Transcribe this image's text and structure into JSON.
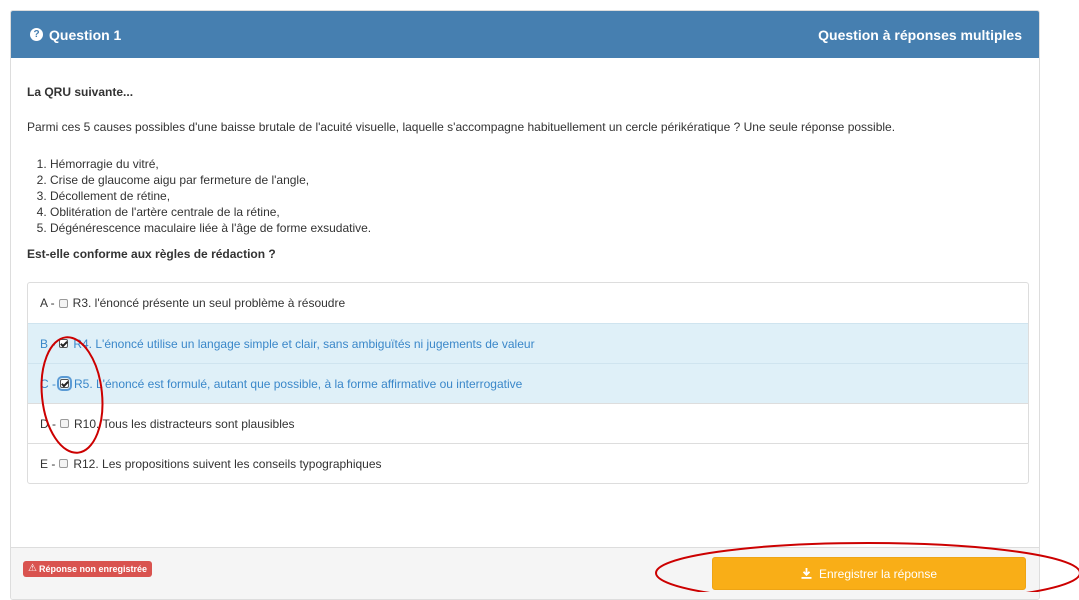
{
  "header": {
    "title": "Question 1",
    "type_label": "Question à réponses multiples",
    "icon": "question-circle-icon"
  },
  "body": {
    "intro": "La QRU suivante...",
    "stem": "Parmi ces 5 causes possibles d'une baisse brutale de l'acuité visuelle, laquelle s'accompagne habituellement un cercle périkératique ? Une seule réponse possible.",
    "causes": [
      "Hémorragie du vitré,",
      "Crise de glaucome aigu par fermeture de l'angle,",
      "Décollement de rétine,",
      "Oblitération de l'artère centrale de la rétine,",
      "Dégénérescence maculaire liée à l'âge de forme exsudative."
    ],
    "question": "Est-elle conforme aux règles de rédaction ?"
  },
  "options": [
    {
      "letter": "A -",
      "text": "R3. l'énoncé présente un seul problème à résoudre",
      "checked": false
    },
    {
      "letter": "B -",
      "text": "R4. L'énoncé utilise un langage simple et clair, sans ambiguïtés ni jugements de valeur",
      "checked": true
    },
    {
      "letter": "C -",
      "text": "R5. L'énoncé est formulé, autant que possible, à la forme affirmative ou interrogative",
      "checked": true
    },
    {
      "letter": "D -",
      "text": "R10. Tous les distracteurs sont plausibles",
      "checked": false
    },
    {
      "letter": "E -",
      "text": "R12. Les propositions suivent les conseils typographiques",
      "checked": false
    }
  ],
  "footer": {
    "status_badge": "Réponse non enregistrée",
    "save_label": "Enregistrer la réponse"
  },
  "colors": {
    "header": "#467fb0",
    "selected_row": "#dff0f8",
    "selected_text": "#3a87c9",
    "badge": "#d9534f",
    "save_button": "#f9ae17",
    "annotation": "#cc0000"
  }
}
